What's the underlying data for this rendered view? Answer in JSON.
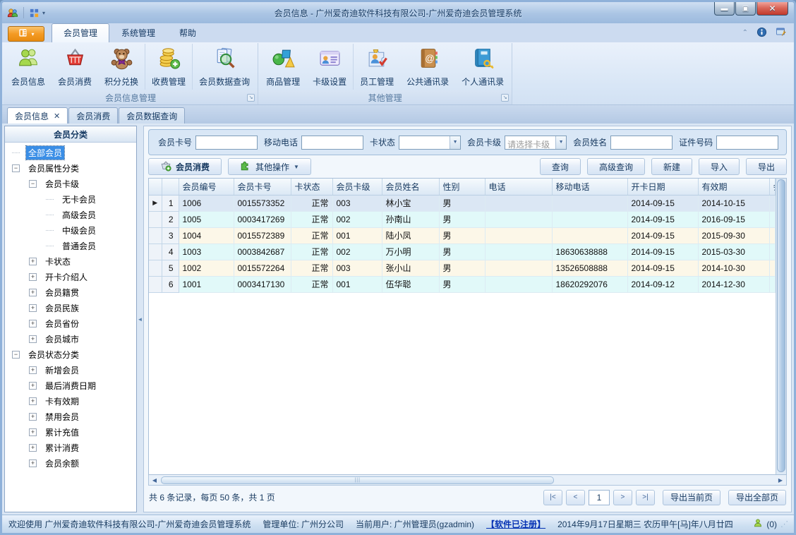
{
  "window": {
    "title": "会员信息 - 广州爱奇迪软件科技有限公司-广州爱奇迪会员管理系统"
  },
  "menu_tabs": [
    {
      "label": "会员管理",
      "active": true
    },
    {
      "label": "系统管理",
      "active": false
    },
    {
      "label": "帮助",
      "active": false
    }
  ],
  "ribbon": {
    "groups": [
      {
        "label": "会员信息管理",
        "items": [
          {
            "label": "会员信息",
            "icon": "members-icon",
            "name": "ribbon-member-info"
          },
          {
            "label": "会员消费",
            "icon": "basket-icon",
            "name": "ribbon-member-consume"
          },
          {
            "label": "积分兑换",
            "icon": "teddy-bear-icon",
            "name": "ribbon-points-exchange"
          },
          {
            "label": "收费管理",
            "icon": "coins-icon",
            "name": "ribbon-fee-management",
            "sep": true
          },
          {
            "label": "会员数据查询",
            "icon": "search-docs-icon",
            "name": "ribbon-member-data-query",
            "sep": true
          }
        ]
      },
      {
        "label": "其他管理",
        "items": [
          {
            "label": "商品管理",
            "icon": "goods-icon",
            "name": "ribbon-goods-management"
          },
          {
            "label": "卡级设置",
            "icon": "card-icon",
            "name": "ribbon-card-level-settings"
          },
          {
            "label": "员工管理",
            "icon": "staff-icon",
            "name": "ribbon-staff-management",
            "sep": true
          },
          {
            "label": "公共通讯录",
            "icon": "address-book-icon",
            "name": "ribbon-public-contacts"
          },
          {
            "label": "个人通讯录",
            "icon": "personal-book-icon",
            "name": "ribbon-personal-contacts"
          }
        ]
      }
    ]
  },
  "doc_tabs": [
    {
      "label": "会员信息",
      "active": true,
      "closable": true
    },
    {
      "label": "会员消费",
      "active": false,
      "closable": false
    },
    {
      "label": "会员数据查询",
      "active": false,
      "closable": false
    }
  ],
  "sidebar": {
    "header": "会员分类",
    "tree": [
      {
        "label": "全部会员",
        "level": 0,
        "expander": null,
        "icon": "all-members-icon",
        "selected": true
      },
      {
        "label": "会员属性分类",
        "level": 0,
        "expander": "minus",
        "icon": "category-icon"
      },
      {
        "label": "会员卡级",
        "level": 1,
        "expander": "minus",
        "icon": "subcategory-icon"
      },
      {
        "label": "无卡会员",
        "level": 2,
        "expander": null,
        "icon": "member-level-icon"
      },
      {
        "label": "高级会员",
        "level": 2,
        "expander": null,
        "icon": "member-level-icon"
      },
      {
        "label": "中级会员",
        "level": 2,
        "expander": null,
        "icon": "member-level-icon"
      },
      {
        "label": "普通会员",
        "level": 2,
        "expander": null,
        "icon": "member-level-icon"
      },
      {
        "label": "卡状态",
        "level": 1,
        "expander": "plus",
        "icon": "subcategory-icon"
      },
      {
        "label": "开卡介绍人",
        "level": 1,
        "expander": "plus",
        "icon": "subcategory-icon"
      },
      {
        "label": "会员籍贯",
        "level": 1,
        "expander": "plus",
        "icon": "subcategory-icon"
      },
      {
        "label": "会员民族",
        "level": 1,
        "expander": "plus",
        "icon": "subcategory-icon"
      },
      {
        "label": "会员省份",
        "level": 1,
        "expander": "plus",
        "icon": "subcategory-icon"
      },
      {
        "label": "会员城市",
        "level": 1,
        "expander": "plus",
        "icon": "subcategory-icon"
      },
      {
        "label": "会员状态分类",
        "level": 0,
        "expander": "minus",
        "icon": "category-icon"
      },
      {
        "label": "新增会员",
        "level": 1,
        "expander": "plus",
        "icon": "subcategory-icon"
      },
      {
        "label": "最后消费日期",
        "level": 1,
        "expander": "plus",
        "icon": "subcategory-icon"
      },
      {
        "label": "卡有效期",
        "level": 1,
        "expander": "plus",
        "icon": "subcategory-icon"
      },
      {
        "label": "禁用会员",
        "level": 1,
        "expander": "plus",
        "icon": "subcategory-icon"
      },
      {
        "label": "累计充值",
        "level": 1,
        "expander": "plus",
        "icon": "subcategory-icon"
      },
      {
        "label": "累计消费",
        "level": 1,
        "expander": "plus",
        "icon": "subcategory-icon"
      },
      {
        "label": "会员余额",
        "level": 1,
        "expander": "plus",
        "icon": "subcategory-icon"
      }
    ]
  },
  "filters": [
    {
      "label": "会员卡号",
      "type": "text",
      "value": "",
      "name": "card-no-input"
    },
    {
      "label": "移动电话",
      "type": "text",
      "value": "",
      "name": "mobile-input"
    },
    {
      "label": "卡状态",
      "type": "select",
      "value": "",
      "name": "card-status-select"
    },
    {
      "label": "会员卡级",
      "type": "select",
      "value": "请选择卡级",
      "name": "card-level-select"
    },
    {
      "label": "会员姓名",
      "type": "text",
      "value": "",
      "name": "member-name-input"
    },
    {
      "label": "证件号码",
      "type": "text",
      "value": "",
      "name": "id-number-input"
    }
  ],
  "toolbar": {
    "consume_label": "会员消费",
    "other_label": "其他操作",
    "actions": [
      {
        "label": "查询",
        "name": "query-button"
      },
      {
        "label": "高级查询",
        "name": "advanced-query-button"
      },
      {
        "label": "新建",
        "name": "new-button"
      },
      {
        "label": "导入",
        "name": "import-button"
      },
      {
        "label": "导出",
        "name": "export-button"
      }
    ]
  },
  "table": {
    "columns": [
      "",
      "",
      "会员编号",
      "会员卡号",
      "卡状态",
      "会员卡级",
      "会员姓名",
      "性别",
      "电话",
      "移动电话",
      "开卡日期",
      "有效期",
      "会员"
    ],
    "rows": [
      [
        "1006",
        "0015573352",
        "正常",
        "003",
        "林小宝",
        "男",
        "",
        "",
        "2014-09-15",
        "2014-10-15",
        ""
      ],
      [
        "1005",
        "0003417269",
        "正常",
        "002",
        "孙南山",
        "男",
        "",
        "",
        "2014-09-15",
        "2016-09-15",
        ""
      ],
      [
        "1004",
        "0015572389",
        "正常",
        "001",
        "陆小凤",
        "男",
        "",
        "",
        "2014-09-15",
        "2015-09-30",
        ""
      ],
      [
        "1003",
        "0003842687",
        "正常",
        "002",
        "万小明",
        "男",
        "",
        "18630638888",
        "2014-09-15",
        "2015-03-30",
        ""
      ],
      [
        "1002",
        "0015572264",
        "正常",
        "003",
        "张小山",
        "男",
        "",
        "13526508888",
        "2014-09-15",
        "2014-10-30",
        ""
      ],
      [
        "1001",
        "0003417130",
        "正常",
        "001",
        "伍华聪",
        "男",
        "",
        "18620292076",
        "2014-09-12",
        "2014-12-30",
        ""
      ]
    ]
  },
  "pagination": {
    "summary": "共 6 条记录，每页 50 条，共 1 页",
    "first": "|<",
    "prev": "<",
    "page": "1",
    "next": ">",
    "last": ">|",
    "export_current": "导出当前页",
    "export_all": "导出全部页"
  },
  "statusbar": {
    "welcome": "欢迎使用 广州爱奇迪软件科技有限公司-广州爱奇迪会员管理系统",
    "unit": "管理单位: 广州分公司",
    "user": "当前用户: 广州管理员(gzadmin)",
    "registered": "【软件已注册】",
    "date": "2014年9月17日星期三 农历甲午[马]年八月廿四",
    "online_count": "(0)"
  }
}
